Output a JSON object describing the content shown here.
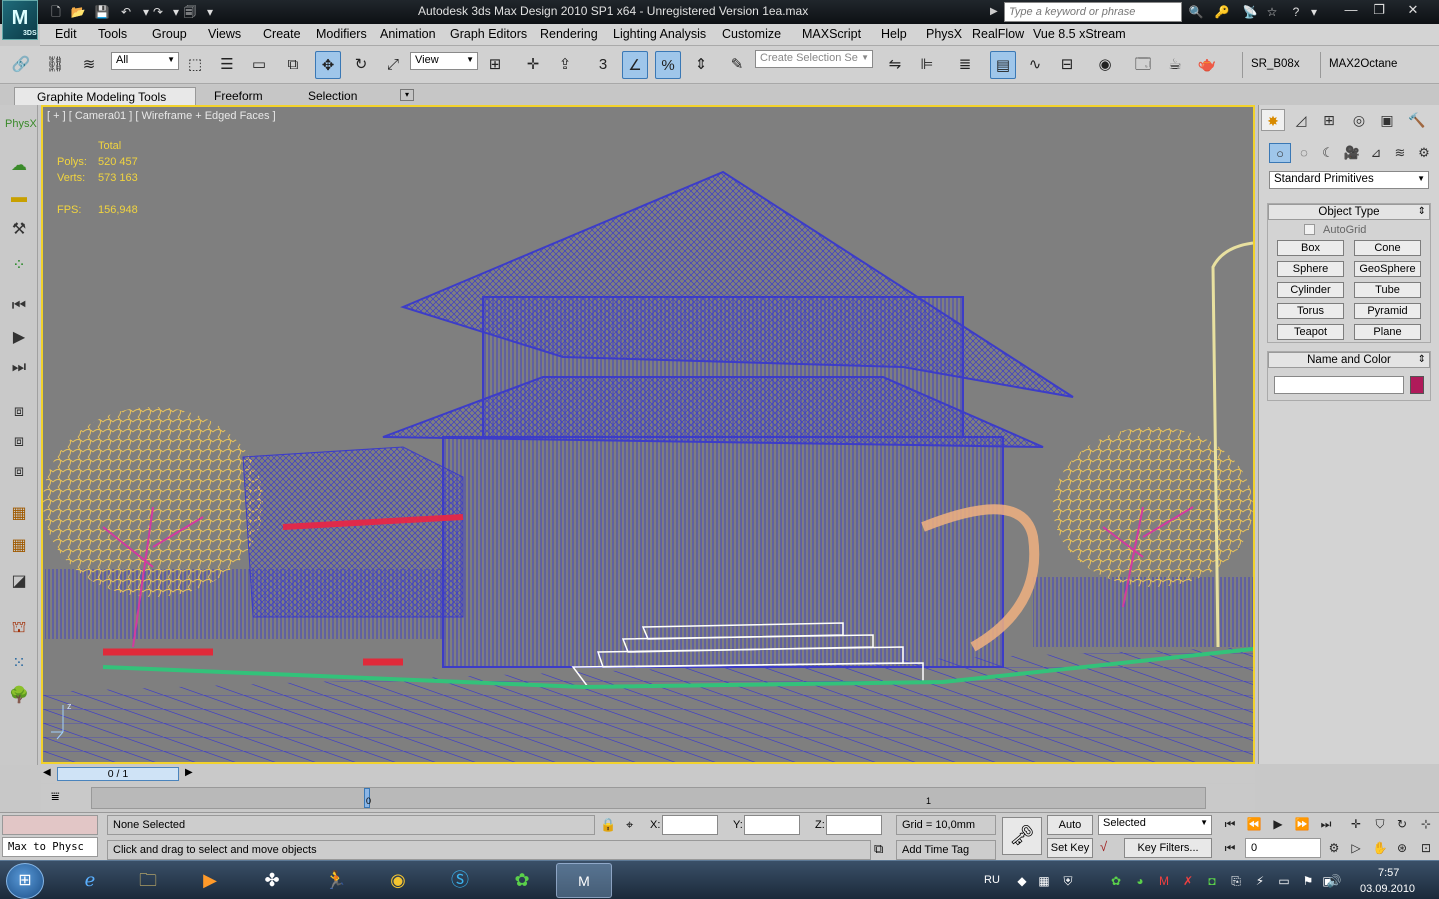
{
  "window": {
    "title": "Autodesk 3ds Max Design 2010 SP1 x64   -   Unregistered Version        1ea.max",
    "logo": "M",
    "logo_sub": "3DS",
    "search_placeholder": "Type a keyword or phrase"
  },
  "menu": [
    "Edit",
    "Tools",
    "Group",
    "Views",
    "Create",
    "Modifiers",
    "Animation",
    "Graph Editors",
    "Rendering",
    "Lighting Analysis",
    "Customize",
    "MAXScript",
    "Help",
    "PhysX",
    "RealFlow",
    "Vue 8.5 xStream"
  ],
  "toolbar": {
    "selection_filter": "All",
    "reference_coord": "View",
    "named_selection_placeholder": "Create Selection Se",
    "snap_value": "3",
    "plugin_1": "SR_B08x",
    "plugin_2": "MAX2Octane"
  },
  "ribbon": {
    "tabs": [
      "Graphite Modeling Tools",
      "Freeform",
      "Selection"
    ]
  },
  "viewport": {
    "label": "[ + ] [ Camera01 ] [ Wireframe + Edged Faces ]",
    "stats": {
      "total_label": "Total",
      "polys_label": "Polys:",
      "polys_value": "520 457",
      "verts_label": "Verts:",
      "verts_value": "573 163",
      "fps_label": "FPS:",
      "fps_value": "156,948"
    },
    "axis_label": "z",
    "colors": {
      "house": "#3c3cc8",
      "trees": "#e8c25a",
      "branches": "#d23aa0",
      "steps": "#ffffff",
      "ground_edge": "#33c27a",
      "background": "#7f7f7f",
      "border": "#f2d22b"
    }
  },
  "command_panel": {
    "category": "Standard Primitives",
    "object_type": {
      "title": "Object Type",
      "autogrid": "AutoGrid",
      "buttons": [
        "Box",
        "Cone",
        "Sphere",
        "GeoSphere",
        "Cylinder",
        "Tube",
        "Torus",
        "Pyramid",
        "Teapot",
        "Plane"
      ]
    },
    "name_and_color": {
      "title": "Name and Color",
      "color": "#b01a5a"
    }
  },
  "timeline": {
    "frame": "0 / 1",
    "track_marks": [
      "0",
      "1"
    ]
  },
  "status": {
    "maxscript_listener": "Max to Physc",
    "selection": "None Selected",
    "prompt": "Click and drag to select and move objects",
    "x_label": "X:",
    "y_label": "Y:",
    "z_label": "Z:",
    "grid": "Grid = 10,0mm",
    "add_time_tag": "Add Time Tag",
    "auto_key": "Auto Key",
    "set_key": "Set Key",
    "key_mode": "Selected",
    "key_filters": "Key Filters...",
    "current_frame": "0"
  },
  "taskbar": {
    "lang": "RU",
    "time": "7:57",
    "date": "03.09.2010"
  }
}
